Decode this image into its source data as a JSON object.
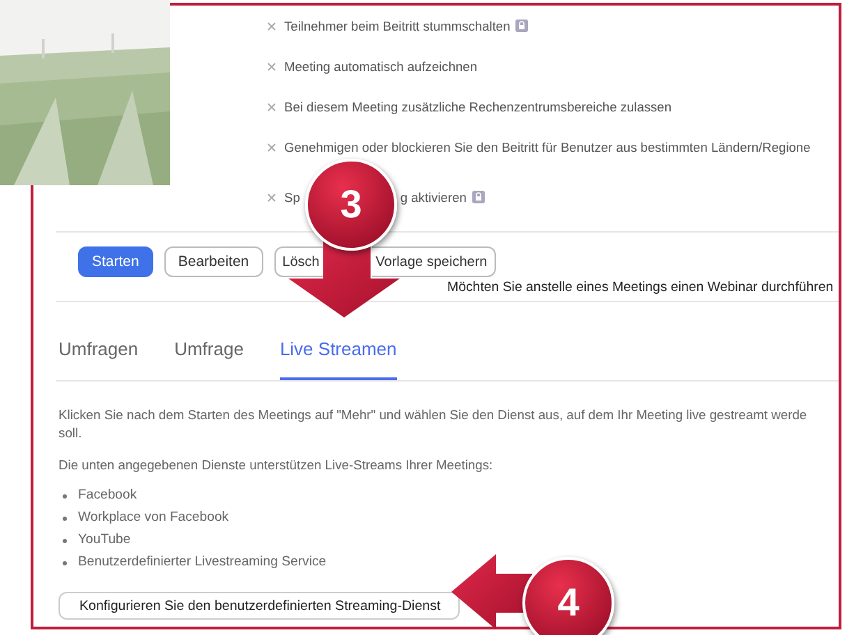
{
  "options": [
    {
      "label": "Teilnehmer beim Beitritt stummschalten",
      "locked": true
    },
    {
      "label": "Meeting automatisch aufzeichnen",
      "locked": false
    },
    {
      "label": "Bei diesem Meeting zusätzliche Rechenzentrumsbereiche zulassen",
      "locked": false
    },
    {
      "label": "Genehmigen oder blockieren Sie den Beitritt für Benutzer aus bestimmten Ländern/Regione",
      "locked": false
    },
    {
      "label": "Sp",
      "label_after": "g aktivieren",
      "locked": true
    }
  ],
  "buttons": [
    {
      "label": "Starten",
      "kind": "primary"
    },
    {
      "label": "Bearbeiten",
      "kind": "secondary"
    },
    {
      "label": "Lösch",
      "kind": "cut_right"
    },
    {
      "label": "Vorlage speichern",
      "kind": "cut_left"
    }
  ],
  "webinar_hint": "Möchten Sie anstelle eines Meetings einen Webinar durchführen",
  "tabs": [
    {
      "label": "Umfragen",
      "selected": false
    },
    {
      "label": "Umfrage",
      "selected": false
    },
    {
      "label": "Live Streamen",
      "selected": true
    }
  ],
  "paragraphs": [
    "Klicken Sie nach dem Starten des Meetings auf \"Mehr\" und wählen Sie den Dienst aus, auf dem Ihr Meeting live gestreamt werde",
    "soll."
  ],
  "services_intro": "Die unten angegebenen Dienste unterstützen Live-Streams Ihrer Meetings:",
  "services": [
    "Facebook",
    "Workplace von Facebook",
    "YouTube",
    "Benutzerdefinierter Livestreaming Service"
  ],
  "configure_button": "Konfigurieren Sie den benutzerdefinierten Streaming-Dienst",
  "callouts": [
    {
      "label": "3",
      "kind": "down"
    },
    {
      "label": "4",
      "kind": "left"
    }
  ],
  "overlay": {
    "kind": "picture"
  }
}
